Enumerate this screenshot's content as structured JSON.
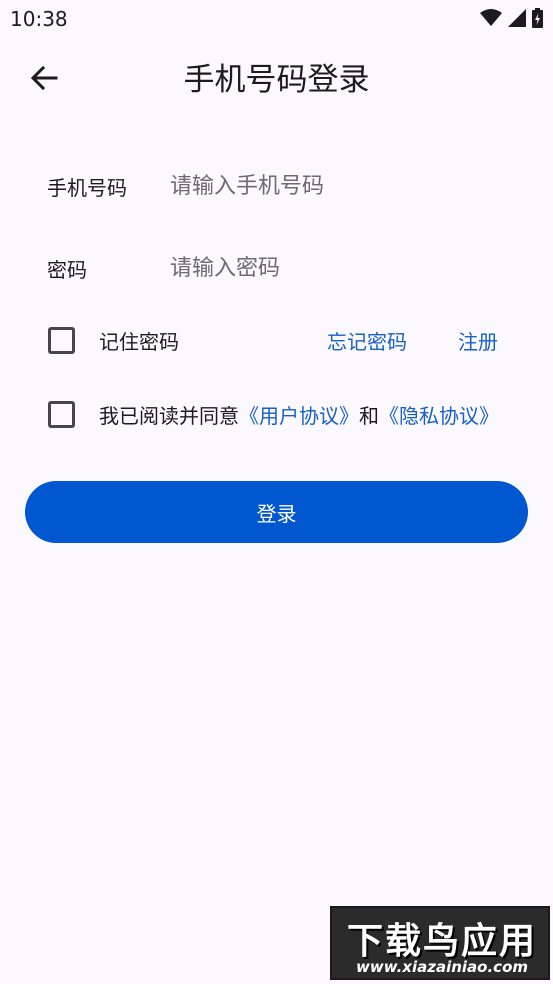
{
  "status_bar": {
    "time": "10:38",
    "icons": [
      "wifi-icon",
      "signal-icon",
      "battery-charging-icon"
    ]
  },
  "header": {
    "back_icon": "arrow-left-icon",
    "title": "手机号码登录"
  },
  "form": {
    "phone": {
      "label": "手机号码",
      "placeholder": "请输入手机号码",
      "value": ""
    },
    "password": {
      "label": "密码",
      "placeholder": "请输入密码",
      "value": ""
    }
  },
  "options": {
    "remember_label": "记住密码",
    "remember_checked": false,
    "forgot_label": "忘记密码",
    "register_label": "注册"
  },
  "agreement": {
    "checked": false,
    "prefix": "我已阅读并同意",
    "user_agreement": "《用户协议》",
    "conjunction": "和",
    "privacy_policy": "《隐私协议》"
  },
  "login_button": {
    "label": "登录"
  },
  "watermark": {
    "line1": "下载鸟应用",
    "line2": "www.xiazainiao.com"
  },
  "colors": {
    "background": "#fcf8ff",
    "primary": "#0057cf",
    "link": "#1760c8",
    "text": "#1c1b1f",
    "placeholder": "#6d6a72"
  }
}
